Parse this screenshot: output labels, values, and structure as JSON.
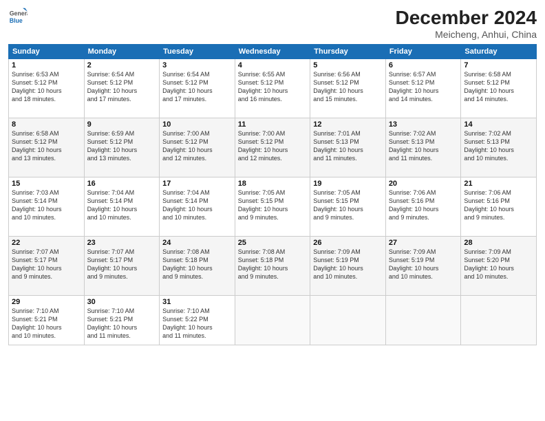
{
  "header": {
    "logo": {
      "general": "General",
      "blue": "Blue"
    },
    "month": "December 2024",
    "location": "Meicheng, Anhui, China"
  },
  "weekdays": [
    "Sunday",
    "Monday",
    "Tuesday",
    "Wednesday",
    "Thursday",
    "Friday",
    "Saturday"
  ],
  "weeks": [
    [
      {
        "day": 1,
        "info": "Sunrise: 6:53 AM\nSunset: 5:12 PM\nDaylight: 10 hours\nand 18 minutes."
      },
      {
        "day": 2,
        "info": "Sunrise: 6:54 AM\nSunset: 5:12 PM\nDaylight: 10 hours\nand 17 minutes."
      },
      {
        "day": 3,
        "info": "Sunrise: 6:54 AM\nSunset: 5:12 PM\nDaylight: 10 hours\nand 17 minutes."
      },
      {
        "day": 4,
        "info": "Sunrise: 6:55 AM\nSunset: 5:12 PM\nDaylight: 10 hours\nand 16 minutes."
      },
      {
        "day": 5,
        "info": "Sunrise: 6:56 AM\nSunset: 5:12 PM\nDaylight: 10 hours\nand 15 minutes."
      },
      {
        "day": 6,
        "info": "Sunrise: 6:57 AM\nSunset: 5:12 PM\nDaylight: 10 hours\nand 14 minutes."
      },
      {
        "day": 7,
        "info": "Sunrise: 6:58 AM\nSunset: 5:12 PM\nDaylight: 10 hours\nand 14 minutes."
      }
    ],
    [
      {
        "day": 8,
        "info": "Sunrise: 6:58 AM\nSunset: 5:12 PM\nDaylight: 10 hours\nand 13 minutes."
      },
      {
        "day": 9,
        "info": "Sunrise: 6:59 AM\nSunset: 5:12 PM\nDaylight: 10 hours\nand 13 minutes."
      },
      {
        "day": 10,
        "info": "Sunrise: 7:00 AM\nSunset: 5:12 PM\nDaylight: 10 hours\nand 12 minutes."
      },
      {
        "day": 11,
        "info": "Sunrise: 7:00 AM\nSunset: 5:12 PM\nDaylight: 10 hours\nand 12 minutes."
      },
      {
        "day": 12,
        "info": "Sunrise: 7:01 AM\nSunset: 5:13 PM\nDaylight: 10 hours\nand 11 minutes."
      },
      {
        "day": 13,
        "info": "Sunrise: 7:02 AM\nSunset: 5:13 PM\nDaylight: 10 hours\nand 11 minutes."
      },
      {
        "day": 14,
        "info": "Sunrise: 7:02 AM\nSunset: 5:13 PM\nDaylight: 10 hours\nand 10 minutes."
      }
    ],
    [
      {
        "day": 15,
        "info": "Sunrise: 7:03 AM\nSunset: 5:14 PM\nDaylight: 10 hours\nand 10 minutes."
      },
      {
        "day": 16,
        "info": "Sunrise: 7:04 AM\nSunset: 5:14 PM\nDaylight: 10 hours\nand 10 minutes."
      },
      {
        "day": 17,
        "info": "Sunrise: 7:04 AM\nSunset: 5:14 PM\nDaylight: 10 hours\nand 10 minutes."
      },
      {
        "day": 18,
        "info": "Sunrise: 7:05 AM\nSunset: 5:15 PM\nDaylight: 10 hours\nand 9 minutes."
      },
      {
        "day": 19,
        "info": "Sunrise: 7:05 AM\nSunset: 5:15 PM\nDaylight: 10 hours\nand 9 minutes."
      },
      {
        "day": 20,
        "info": "Sunrise: 7:06 AM\nSunset: 5:16 PM\nDaylight: 10 hours\nand 9 minutes."
      },
      {
        "day": 21,
        "info": "Sunrise: 7:06 AM\nSunset: 5:16 PM\nDaylight: 10 hours\nand 9 minutes."
      }
    ],
    [
      {
        "day": 22,
        "info": "Sunrise: 7:07 AM\nSunset: 5:17 PM\nDaylight: 10 hours\nand 9 minutes."
      },
      {
        "day": 23,
        "info": "Sunrise: 7:07 AM\nSunset: 5:17 PM\nDaylight: 10 hours\nand 9 minutes."
      },
      {
        "day": 24,
        "info": "Sunrise: 7:08 AM\nSunset: 5:18 PM\nDaylight: 10 hours\nand 9 minutes."
      },
      {
        "day": 25,
        "info": "Sunrise: 7:08 AM\nSunset: 5:18 PM\nDaylight: 10 hours\nand 9 minutes."
      },
      {
        "day": 26,
        "info": "Sunrise: 7:09 AM\nSunset: 5:19 PM\nDaylight: 10 hours\nand 10 minutes."
      },
      {
        "day": 27,
        "info": "Sunrise: 7:09 AM\nSunset: 5:19 PM\nDaylight: 10 hours\nand 10 minutes."
      },
      {
        "day": 28,
        "info": "Sunrise: 7:09 AM\nSunset: 5:20 PM\nDaylight: 10 hours\nand 10 minutes."
      }
    ],
    [
      {
        "day": 29,
        "info": "Sunrise: 7:10 AM\nSunset: 5:21 PM\nDaylight: 10 hours\nand 10 minutes."
      },
      {
        "day": 30,
        "info": "Sunrise: 7:10 AM\nSunset: 5:21 PM\nDaylight: 10 hours\nand 11 minutes."
      },
      {
        "day": 31,
        "info": "Sunrise: 7:10 AM\nSunset: 5:22 PM\nDaylight: 10 hours\nand 11 minutes."
      },
      null,
      null,
      null,
      null
    ]
  ]
}
